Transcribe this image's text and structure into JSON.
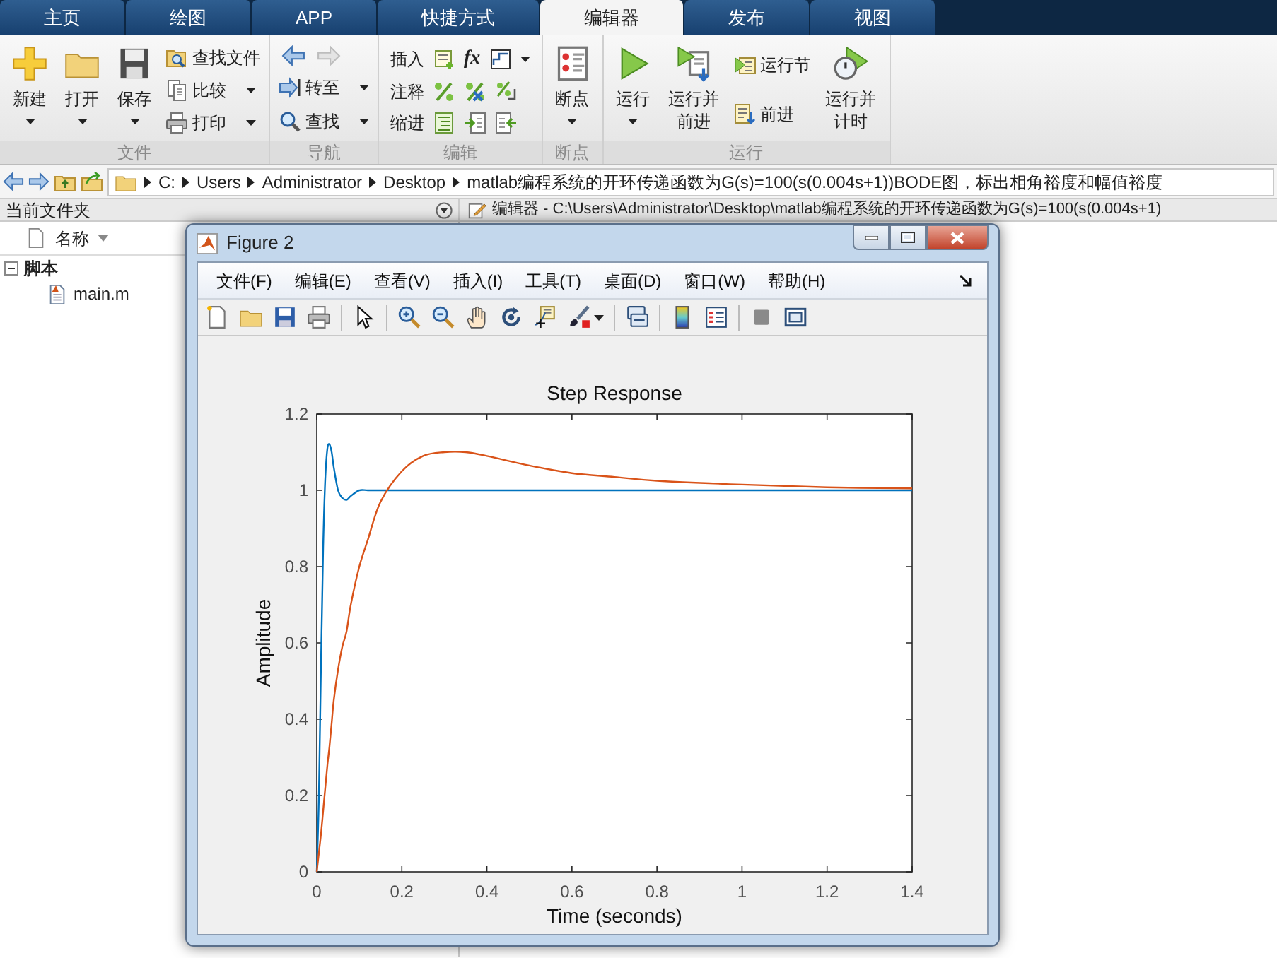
{
  "tabs": [
    {
      "label": "主页",
      "selected": false
    },
    {
      "label": "绘图",
      "selected": false
    },
    {
      "label": "APP",
      "selected": false
    },
    {
      "label": "快捷方式",
      "selected": false
    },
    {
      "label": "编辑器",
      "selected": true
    },
    {
      "label": "发布",
      "selected": false
    },
    {
      "label": "视图",
      "selected": false
    }
  ],
  "ribbon": {
    "groups": [
      {
        "label": "文件",
        "buttons": [
          {
            "kind": "large",
            "label": "新建",
            "dropdown": true
          },
          {
            "kind": "large",
            "label": "打开",
            "dropdown": true
          },
          {
            "kind": "large",
            "label": "保存",
            "dropdown": true
          },
          {
            "kind": "small",
            "label": "查找文件",
            "dropdown": false
          },
          {
            "kind": "small",
            "label": "比较",
            "dropdown": true
          },
          {
            "kind": "small",
            "label": "打印",
            "dropdown": true
          }
        ]
      },
      {
        "label": "导航",
        "buttons": [
          {
            "kind": "arrows"
          },
          {
            "kind": "small",
            "label": "转至",
            "dropdown": true
          },
          {
            "kind": "small",
            "label": "查找",
            "dropdown": true
          }
        ]
      },
      {
        "label": "编辑",
        "buttons": [
          {
            "kind": "icon-row",
            "label": "插入",
            "symbol": "fx",
            "dropdown": true
          },
          {
            "kind": "icon-row",
            "label": "注释",
            "dropdown": false
          },
          {
            "kind": "icon-row",
            "label": "缩进",
            "dropdown": false
          }
        ]
      },
      {
        "label": "断点",
        "buttons": [
          {
            "kind": "large",
            "label": "断点",
            "dropdown": true
          }
        ]
      },
      {
        "label": "运行",
        "buttons": [
          {
            "kind": "large",
            "label": "运行",
            "dropdown": true
          },
          {
            "kind": "large",
            "label": "运行并前进",
            "dropdown": false
          },
          {
            "kind": "small",
            "label": "运行节",
            "dropdown": false
          },
          {
            "kind": "small",
            "label": "前进",
            "dropdown": false
          },
          {
            "kind": "large",
            "label": "运行并计时",
            "dropdown": false
          }
        ]
      }
    ]
  },
  "address_bar": {
    "segments": [
      "C:",
      "Users",
      "Administrator",
      "Desktop",
      "matlab编程系统的开环传递函数为G(s)=100(s(0.004s+1))BODE图，标出相角裕度和幅值裕度"
    ]
  },
  "current_folder": {
    "title": "当前文件夹",
    "column": "名称",
    "tree": [
      {
        "label": "脚本",
        "expanded": true,
        "children": [
          {
            "label": "main.m"
          }
        ]
      }
    ]
  },
  "editor": {
    "title": "编辑器 - C:\\Users\\Administrator\\Desktop\\matlab编程系统的开环传递函数为G(s)=100(s(0.004s+1)"
  },
  "figure": {
    "title": "Figure 2",
    "menu": [
      "文件(F)",
      "编辑(E)",
      "查看(V)",
      "插入(I)",
      "工具(T)",
      "桌面(D)",
      "窗口(W)",
      "帮助(H)"
    ],
    "chart_data": {
      "type": "line",
      "title": "Step Response",
      "xlabel": "Time (seconds)",
      "ylabel": "Amplitude",
      "x": [
        0,
        0.005,
        0.01,
        0.015,
        0.02,
        0.025,
        0.03,
        0.035,
        0.04,
        0.05,
        0.06,
        0.07,
        0.08,
        0.1,
        0.12,
        0.15,
        0.2,
        0.25,
        0.3,
        0.35,
        0.4,
        0.5,
        0.6,
        0.7,
        0.8,
        1.0,
        1.2,
        1.4
      ],
      "series": [
        {
          "color": "#0072bd",
          "values": [
            0,
            0.2,
            0.55,
            0.85,
            1.03,
            1.11,
            1.12,
            1.1,
            1.06,
            1.0,
            0.98,
            0.975,
            0.985,
            1.0,
            1.0,
            1,
            1,
            1,
            1,
            1,
            1,
            1,
            1,
            1,
            1,
            1,
            1,
            1
          ]
        },
        {
          "color": "#d95319",
          "values": [
            0,
            0.05,
            0.1,
            0.16,
            0.22,
            0.28,
            0.33,
            0.39,
            0.45,
            0.53,
            0.59,
            0.63,
            0.7,
            0.8,
            0.87,
            0.97,
            1.05,
            1.09,
            1.1,
            1.1,
            1.09,
            1.065,
            1.045,
            1.035,
            1.025,
            1.015,
            1.008,
            1.005
          ]
        }
      ],
      "xlim": [
        0,
        1.4
      ],
      "ylim": [
        0,
        1.2
      ],
      "xticks": [
        0,
        0.2,
        0.4,
        0.6,
        0.8,
        1,
        1.2,
        1.4
      ],
      "yticks": [
        0,
        0.2,
        0.4,
        0.6,
        0.8,
        1,
        1.2
      ]
    }
  }
}
